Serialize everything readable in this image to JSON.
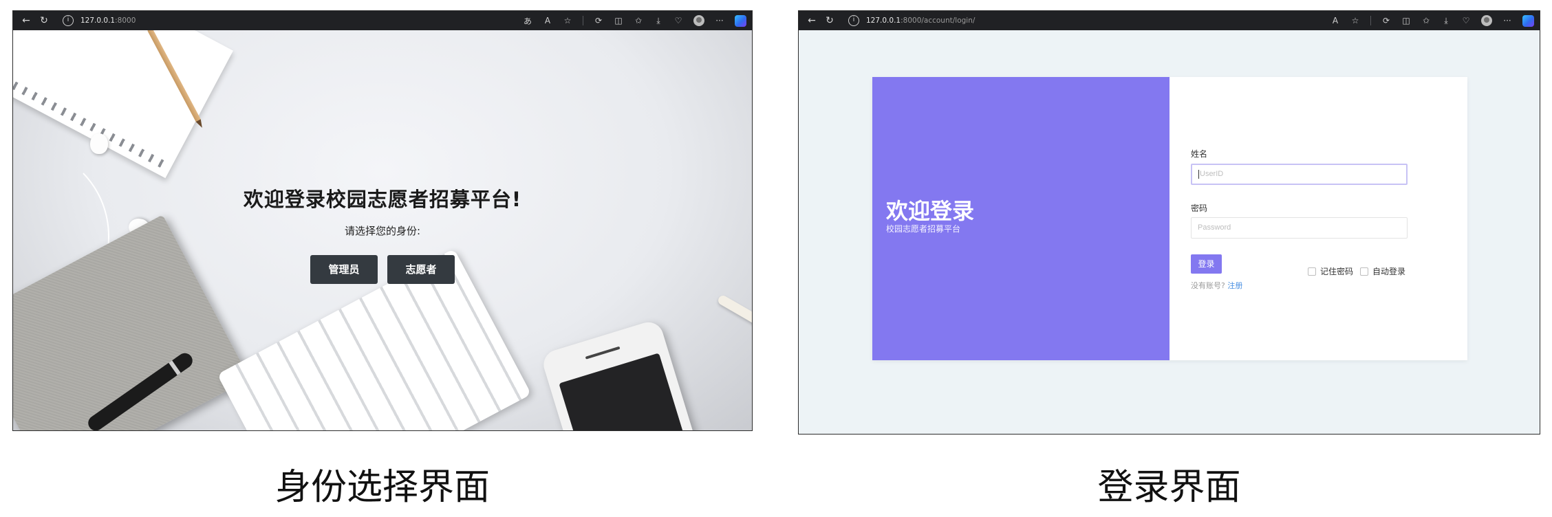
{
  "left_screenshot": {
    "browser": {
      "url_host": "127.0.0.1",
      "url_rest": ":8000"
    },
    "page": {
      "title": "欢迎登录校园志愿者招募平台!",
      "subtitle": "请选择您的身份:",
      "buttons": {
        "admin": "管理员",
        "volunteer": "志愿者"
      }
    },
    "caption": "身份选择界面"
  },
  "right_screenshot": {
    "browser": {
      "url_host": "127.0.0.1",
      "url_rest": ":8000/account/login/"
    },
    "panel": {
      "title": "欢迎登录",
      "subtitle": "校园志愿者招募平台"
    },
    "form": {
      "name_label": "姓名",
      "name_placeholder": "UserID",
      "password_label": "密码",
      "password_placeholder": "Password",
      "login_button": "登录",
      "remember_label": "记住密码",
      "auto_login_label": "自动登录",
      "no_account_text": "没有账号?",
      "register_link": "注册"
    },
    "caption": "登录界面"
  },
  "colors": {
    "accent_purple": "#8378f0",
    "login_bg": "#edf3f6",
    "role_button": "#343a40",
    "browser_chrome": "#202124"
  }
}
